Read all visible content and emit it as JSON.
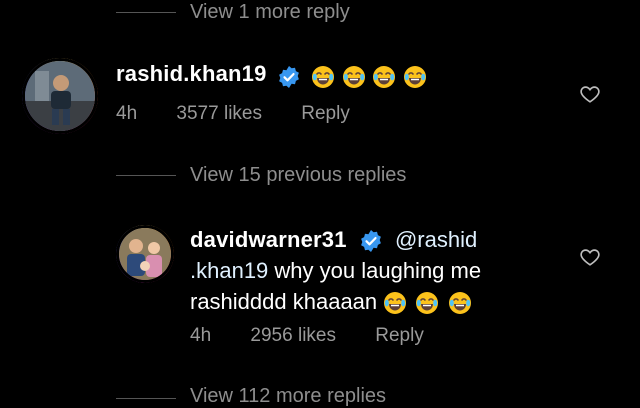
{
  "thread": {
    "view_more_top": "View 1 more reply",
    "view_previous": "View 15 previous replies",
    "view_more_bottom": "View 112 more replies"
  },
  "comments": [
    {
      "username": "rashid.khan19",
      "verified": true,
      "text": "",
      "emojis": [
        "face-with-tears-of-joy",
        "face-with-tears-of-joy",
        "face-with-tears-of-joy",
        "face-with-tears-of-joy"
      ],
      "time": "4h",
      "likes": "3577 likes",
      "reply": "Reply"
    },
    {
      "username": "davidwarner31",
      "verified": true,
      "mention_line1": "@rashid",
      "mention_line2": ".khan19",
      "text_line2": " why you laughing me",
      "text_line3": "rashidddd khaaaan ",
      "emojis": [
        "face-with-tears-of-joy",
        "face-with-tears-of-joy",
        "face-with-tears-of-joy"
      ],
      "time": "4h",
      "likes": "2956 likes",
      "reply": "Reply"
    }
  ],
  "colors": {
    "background": "#000000",
    "verified_blue": "#3897f0",
    "mention_blue": "#e0f1ff",
    "muted": "#9a9a9a"
  }
}
